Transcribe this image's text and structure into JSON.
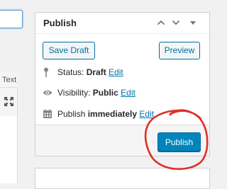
{
  "colors": {
    "accent": "#0073aa",
    "primary_button": "#0085ba",
    "annotation": "#e0302a"
  },
  "editor": {
    "tab_text": "Text",
    "fullscreen_icon": "fullscreen-icon"
  },
  "publish_box": {
    "title": "Publish",
    "header_icons": [
      "chevron-up-icon",
      "chevron-down-icon",
      "toggle-triangle-icon"
    ],
    "save_draft_label": "Save Draft",
    "preview_label": "Preview",
    "status": {
      "label": "Status: ",
      "value": "Draft",
      "edit": "Edit",
      "icon": "pin-icon"
    },
    "visibility": {
      "label": "Visibility: ",
      "value": "Public",
      "edit": "Edit",
      "icon": "eye-icon"
    },
    "publish_time": {
      "label": "Publish ",
      "value": "immediately",
      "edit": "Edit",
      "icon": "calendar-icon"
    },
    "publish_label": "Publish"
  },
  "annotation": {
    "shape": "hand-drawn circle around Publish button"
  }
}
